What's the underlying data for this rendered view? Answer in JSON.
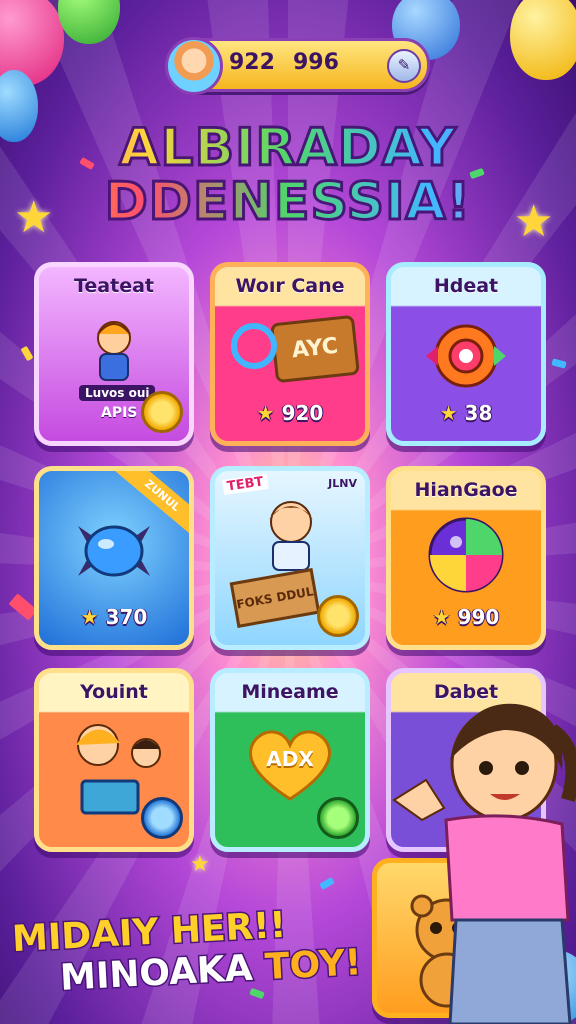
{
  "header": {
    "coins": "922",
    "gems": "996"
  },
  "title": {
    "line1": "ALBIRADAY",
    "line2": "DDENESSIA!"
  },
  "cards": [
    {
      "label": "Teateat",
      "sub1": "Luvos oui",
      "sub2": "APIS",
      "score": "",
      "theme": "#c54be0"
    },
    {
      "label": "Woır Cane",
      "sub1": "AYC",
      "score": "920",
      "theme": "#ff3d8b"
    },
    {
      "label": "Hdeat",
      "score": "38",
      "theme": "#8b4fe8"
    },
    {
      "label": "",
      "ribbon": "ZUNUL",
      "score": "370",
      "theme": "#2f8ff0"
    },
    {
      "label": "TEBT",
      "ribbon": "JLNV",
      "sub1": "FOKS DDUL",
      "score": "",
      "theme": "#4fc3ff"
    },
    {
      "label": "HianGaoe",
      "score": "990",
      "theme": "#ff9d1f"
    },
    {
      "label": "Youint",
      "score": "",
      "theme": "#ff8a4a"
    },
    {
      "label": "Mineame",
      "sub1": "ADX",
      "score": "",
      "theme": "#2fbf5a"
    },
    {
      "label": "Dabet",
      "score": "",
      "theme": "#7a4fd8"
    }
  ],
  "banner": {
    "line1": "MIDAIY HER!!",
    "line2a": "MINOAKA ",
    "line2b": "TOY!"
  }
}
